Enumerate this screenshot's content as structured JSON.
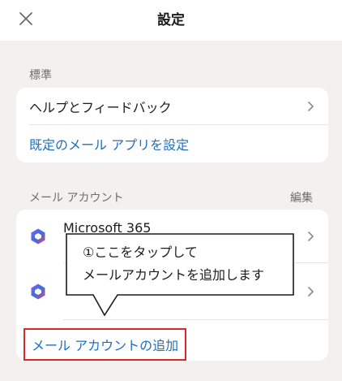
{
  "header": {
    "title": "設定",
    "close_icon": "close-icon"
  },
  "standard": {
    "label": "標準",
    "help_feedback": "ヘルプとフィードバック",
    "default_mail_app": "既定のメール アプリを設定"
  },
  "mail_accounts": {
    "label": "メール アカウント",
    "edit": "編集",
    "accounts": [
      {
        "name": "Microsoft 365",
        "icon": "microsoft-365-icon"
      },
      {
        "name": "",
        "icon": "microsoft-365-icon"
      }
    ],
    "add_account": "メール アカウントの追加"
  },
  "callout": {
    "line1": "①ここをタップして",
    "line2": "メールアカウントを追加します"
  },
  "colors": {
    "background": "#f2f1ef",
    "link": "#1f6fbf",
    "highlight_border": "#d42a2a"
  }
}
